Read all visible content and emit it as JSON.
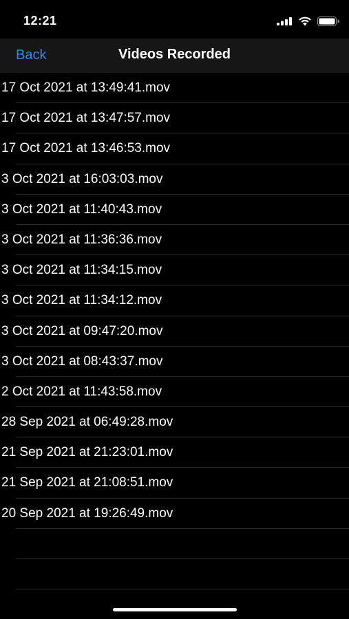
{
  "status_bar": {
    "time": "12:21",
    "icons": [
      "cellular-signal-icon",
      "wifi-icon",
      "battery-icon"
    ]
  },
  "nav": {
    "back_label": "Back",
    "title": "Videos Recorded",
    "back_color": "#3a86e8"
  },
  "videos": [
    "17 Oct 2021 at 13:49:41.mov",
    "17 Oct 2021 at 13:47:57.mov",
    "17 Oct 2021 at 13:46:53.mov",
    "3 Oct 2021 at 16:03:03.mov",
    "3 Oct 2021 at 11:40:43.mov",
    "3 Oct 2021 at 11:36:36.mov",
    "3 Oct 2021 at 11:34:15.mov",
    "3 Oct 2021 at 11:34:12.mov",
    "3 Oct 2021 at 09:47:20.mov",
    "3 Oct 2021 at 08:43:37.mov",
    "2 Oct 2021 at 11:43:58.mov",
    "28 Sep 2021 at 06:49:28.mov",
    "21 Sep 2021 at 21:23:01.mov",
    "21 Sep 2021 at 21:08:51.mov",
    "20 Sep 2021 at 19:26:49.mov"
  ]
}
